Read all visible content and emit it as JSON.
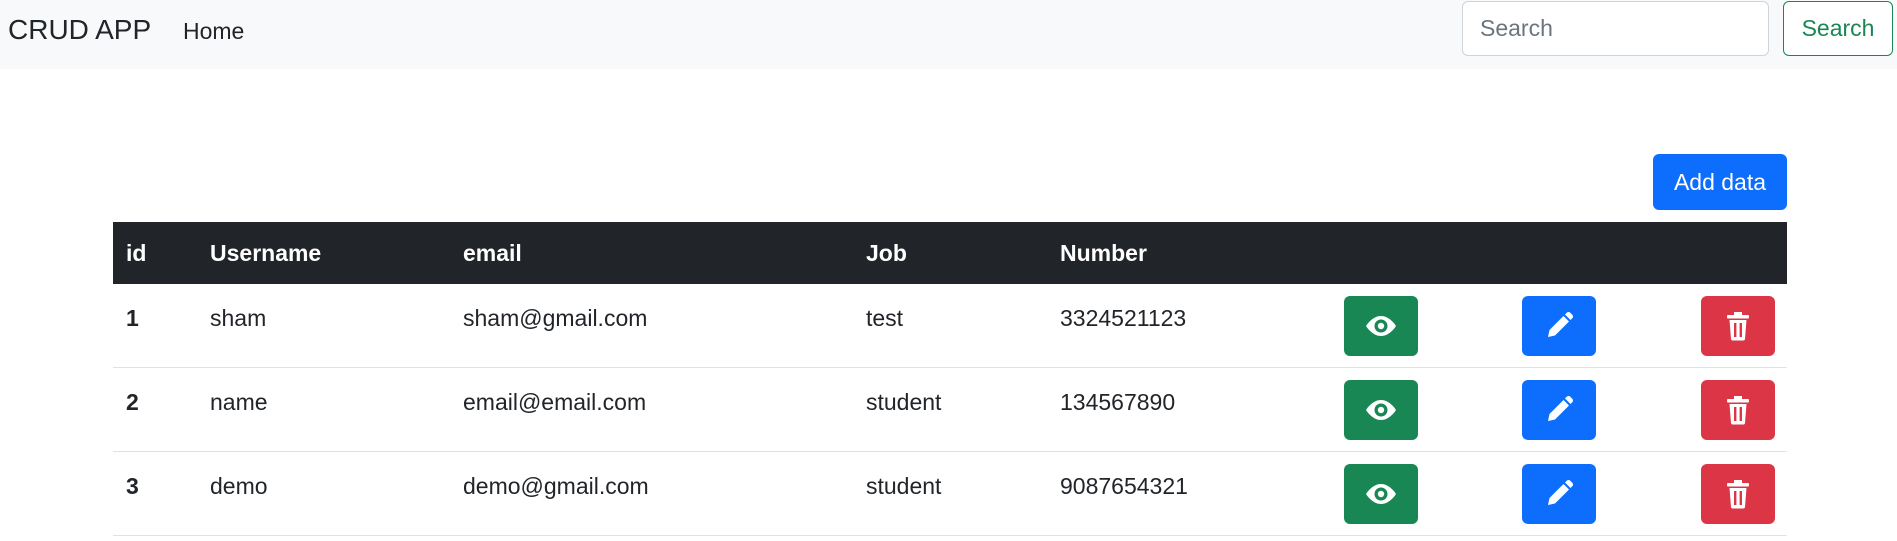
{
  "navbar": {
    "brand": "CRUD APP",
    "home_link": "Home",
    "search_placeholder": "Search",
    "search_button": "Search"
  },
  "actions": {
    "add_button": "Add data"
  },
  "table": {
    "headers": {
      "id": "id",
      "username": "Username",
      "email": "email",
      "job": "Job",
      "number": "Number"
    },
    "rows": [
      {
        "id": "1",
        "username": "sham",
        "email": "sham@gmail.com",
        "job": "test",
        "number": "3324521123"
      },
      {
        "id": "2",
        "username": "name",
        "email": "email@email.com",
        "job": "student",
        "number": "134567890"
      },
      {
        "id": "3",
        "username": "demo",
        "email": "demo@gmail.com",
        "job": "student",
        "number": "9087654321"
      }
    ],
    "row_action_icons": [
      "eye-icon",
      "pencil-icon",
      "trash-icon"
    ]
  },
  "colors": {
    "navbar_bg": "#f8f9fa",
    "header_bg": "#212529",
    "view": "#198754",
    "edit": "#0d6efd",
    "delete": "#dc3545"
  }
}
